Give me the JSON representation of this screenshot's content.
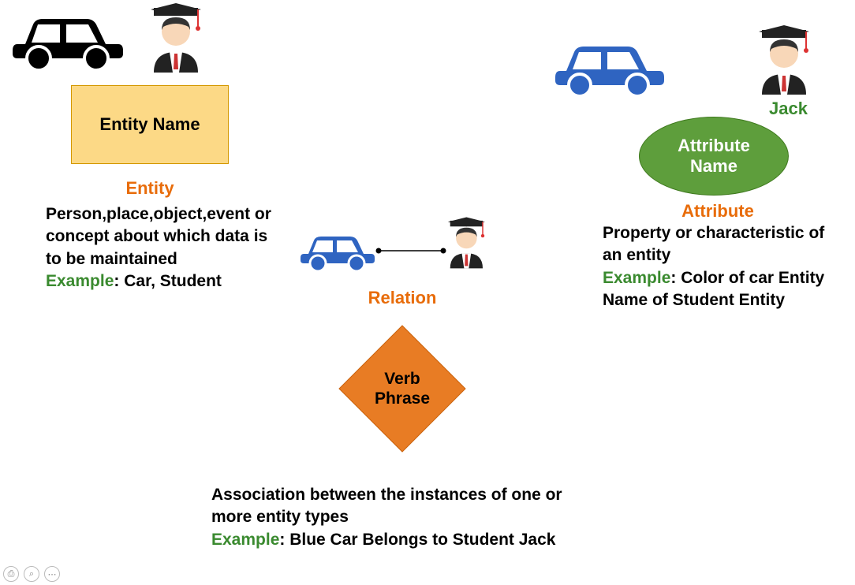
{
  "entity": {
    "shape_label": "Entity Name",
    "title": "Entity",
    "description": "Person,place,object,event or concept about which data is to be maintained",
    "example_label": "Example",
    "example_value": ": Car, Student"
  },
  "relation": {
    "shape_label": "Verb Phrase",
    "title": "Relation",
    "description": "Association between the instances of one or more entity types",
    "example_label": "Example",
    "example_value": ": Blue Car Belongs to Student Jack"
  },
  "attribute": {
    "shape_label": "Attribute Name",
    "title": "Attribute",
    "description": "Property or characteristic of an entity",
    "example_label": "Example",
    "example_value": ": Color of car Entity Name of Student Entity",
    "student_name": "Jack"
  },
  "toolbar": {
    "save": "⎙",
    "zoom": "⌕",
    "more": "⋯"
  }
}
